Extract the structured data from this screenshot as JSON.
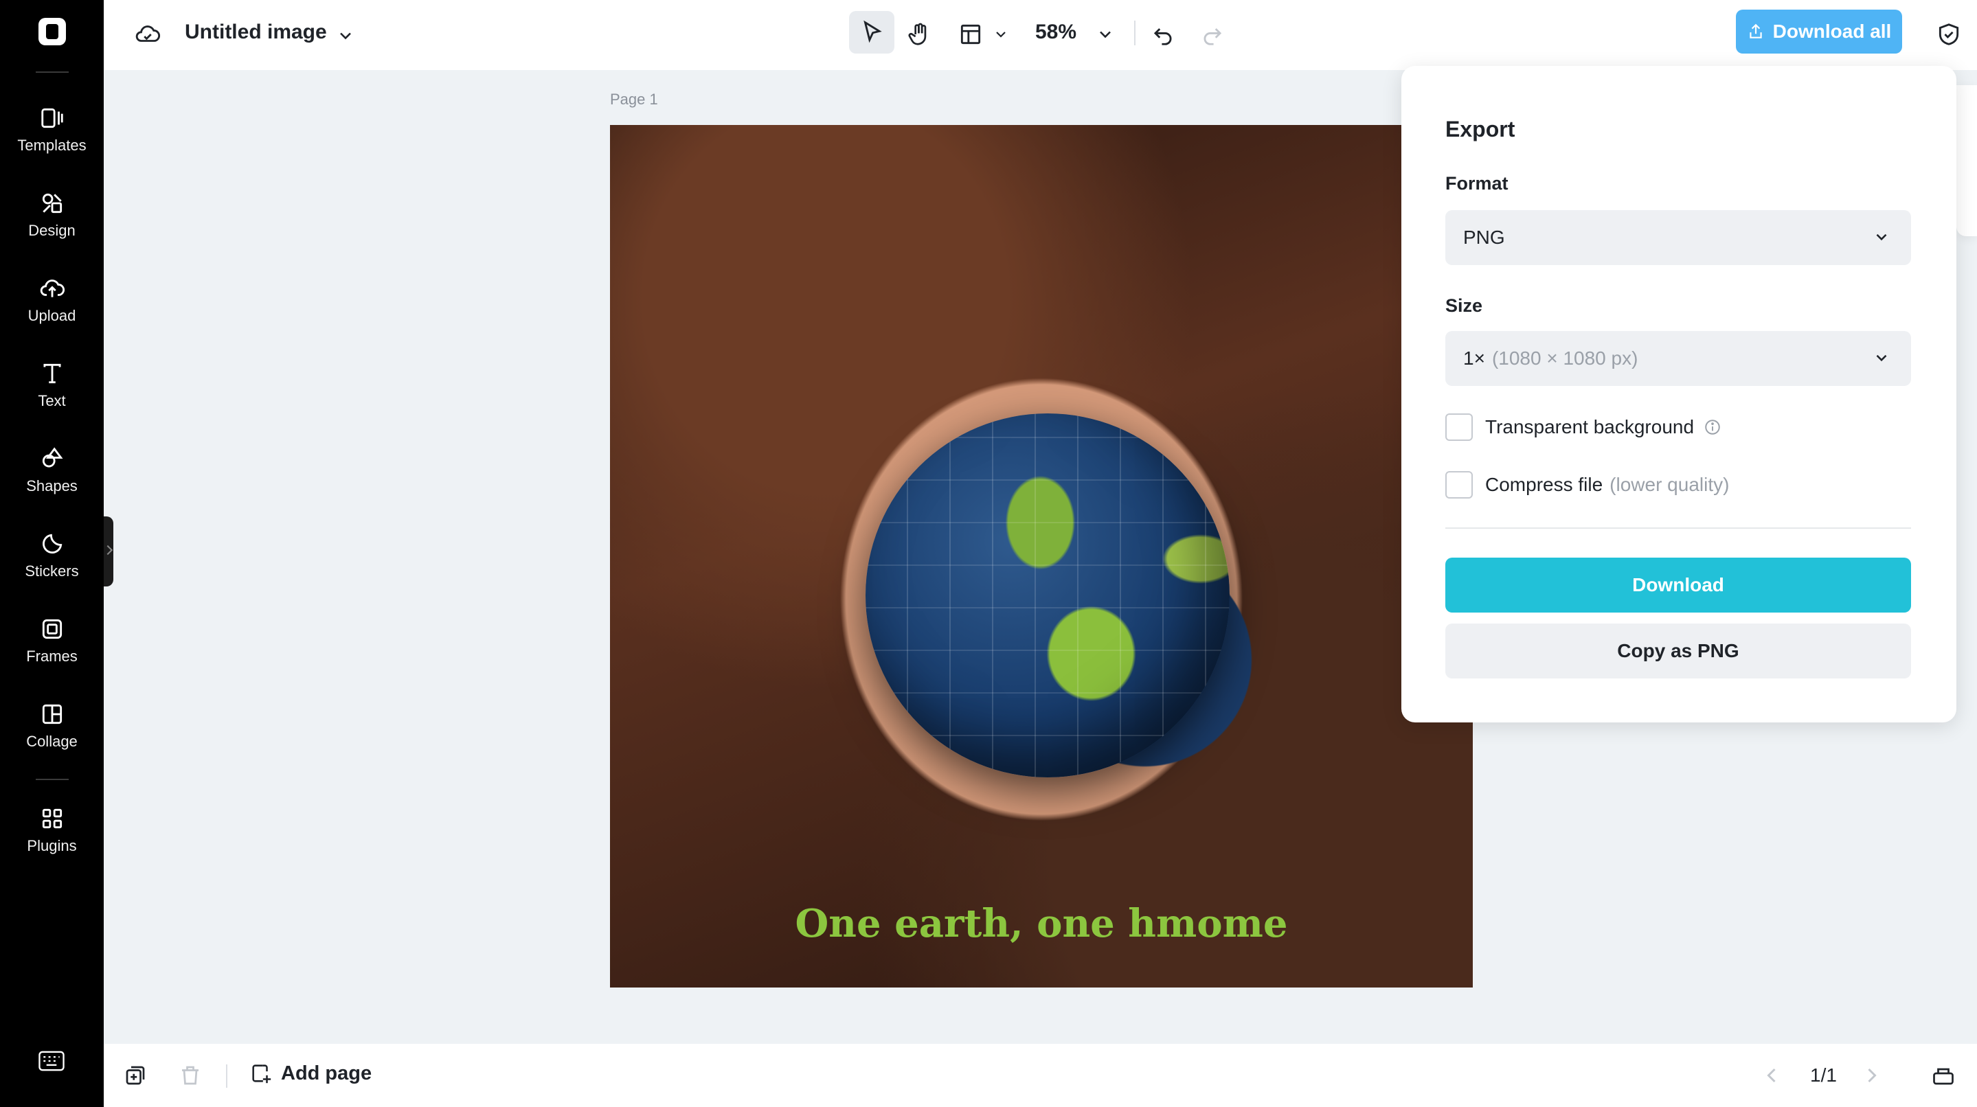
{
  "topbar": {
    "title": "Untitled image",
    "zoom": "58%",
    "download_all_label": "Download all"
  },
  "sidebar": {
    "items": [
      {
        "label": "Templates",
        "icon": "templates-icon"
      },
      {
        "label": "Design",
        "icon": "design-icon"
      },
      {
        "label": "Upload",
        "icon": "upload-icon"
      },
      {
        "label": "Text",
        "icon": "text-icon"
      },
      {
        "label": "Shapes",
        "icon": "shapes-icon"
      },
      {
        "label": "Stickers",
        "icon": "stickers-icon"
      },
      {
        "label": "Frames",
        "icon": "frames-icon"
      },
      {
        "label": "Collage",
        "icon": "collage-icon"
      },
      {
        "label": "Plugins",
        "icon": "plugins-icon"
      }
    ]
  },
  "canvas": {
    "page_label": "Page 1",
    "overlay_text": "One earth, one hmome"
  },
  "export_panel": {
    "heading": "Export",
    "format_label": "Format",
    "format_value": "PNG",
    "size_label": "Size",
    "size_value": "1×",
    "size_detail": "(1080 × 1080 px)",
    "transparent_label": "Transparent background",
    "compress_label": "Compress file",
    "compress_detail": "(lower quality)",
    "download_label": "Download",
    "copy_label": "Copy as PNG"
  },
  "bottombar": {
    "add_page_label": "Add page",
    "page_count": "1/1"
  },
  "colors": {
    "accent_download_all": "#4fb4f5",
    "accent_download": "#22c1d8",
    "canvas_text": "#8cc63f"
  }
}
